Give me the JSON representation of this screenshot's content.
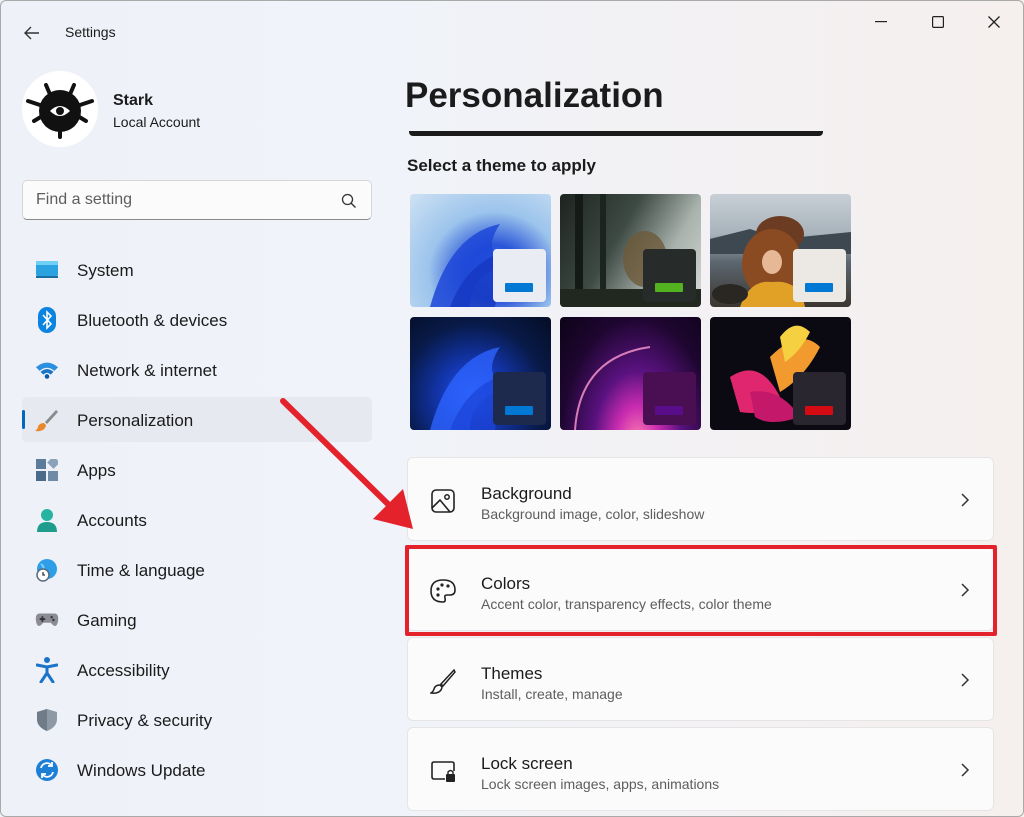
{
  "window": {
    "title": "Settings"
  },
  "user": {
    "name": "Stark",
    "account_type": "Local Account"
  },
  "search": {
    "placeholder": "Find a setting",
    "value": ""
  },
  "sidebar": {
    "items": [
      {
        "label": "System",
        "icon": "monitor-icon"
      },
      {
        "label": "Bluetooth & devices",
        "icon": "bluetooth-icon"
      },
      {
        "label": "Network & internet",
        "icon": "wifi-icon"
      },
      {
        "label": "Personalization",
        "icon": "brush-icon",
        "active": true
      },
      {
        "label": "Apps",
        "icon": "apps-icon"
      },
      {
        "label": "Accounts",
        "icon": "person-icon"
      },
      {
        "label": "Time & language",
        "icon": "globe-clock-icon"
      },
      {
        "label": "Gaming",
        "icon": "gamepad-icon"
      },
      {
        "label": "Accessibility",
        "icon": "accessibility-icon"
      },
      {
        "label": "Privacy & security",
        "icon": "shield-icon"
      },
      {
        "label": "Windows Update",
        "icon": "update-icon"
      }
    ]
  },
  "main": {
    "title": "Personalization",
    "themes_heading": "Select a theme to apply",
    "themes": [
      {
        "name": "windows-light",
        "accent": "#0078d4"
      },
      {
        "name": "glow-forest",
        "accent": "#53b21f"
      },
      {
        "name": "captured-motion",
        "accent": "#0078d4"
      },
      {
        "name": "windows-dark",
        "accent": "#0078d4"
      },
      {
        "name": "sunrise",
        "accent": "#5a0d8a"
      },
      {
        "name": "flow",
        "accent": "#d40b12"
      }
    ],
    "cards": [
      {
        "title": "Background",
        "subtitle": "Background image, color, slideshow",
        "icon": "image-icon"
      },
      {
        "title": "Colors",
        "subtitle": "Accent color, transparency effects, color theme",
        "icon": "palette-icon"
      },
      {
        "title": "Themes",
        "subtitle": "Install, create, manage",
        "icon": "brush-icon"
      },
      {
        "title": "Lock screen",
        "subtitle": "Lock screen images, apps, animations",
        "icon": "lock-screen-icon"
      }
    ]
  },
  "colors": {
    "accent": "#0067c0",
    "highlight": "#e3222b"
  }
}
